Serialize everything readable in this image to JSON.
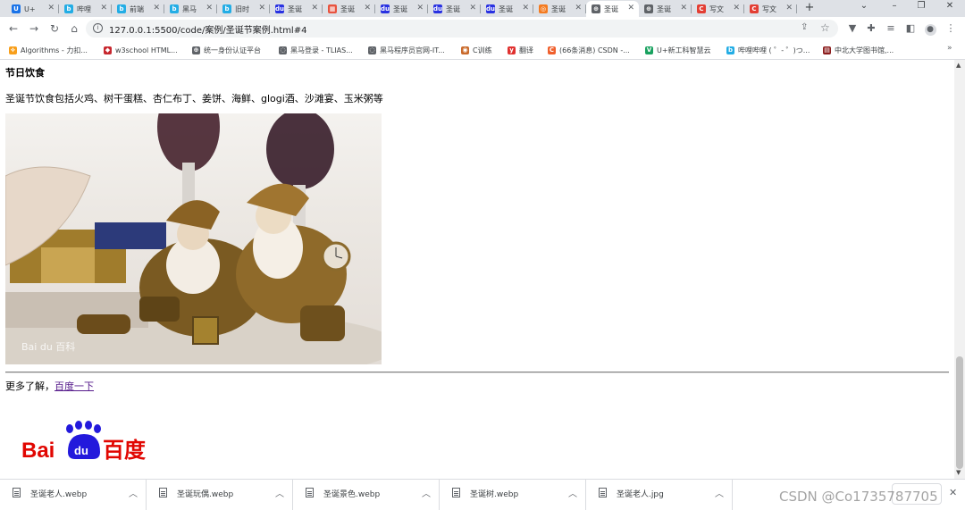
{
  "browser": {
    "tabs": [
      {
        "title": "U+",
        "fav_text": "U",
        "fav_color": "#1a73e8",
        "active": false
      },
      {
        "title": "哔哩",
        "fav_text": "b",
        "fav_color": "#23ade5",
        "active": false
      },
      {
        "title": "前端",
        "fav_text": "b",
        "fav_color": "#23ade5",
        "active": false
      },
      {
        "title": "黑马",
        "fav_text": "b",
        "fav_color": "#23ade5",
        "active": false
      },
      {
        "title": "旧时",
        "fav_text": "b",
        "fav_color": "#23ade5",
        "active": false
      },
      {
        "title": "圣诞",
        "fav_text": "du",
        "fav_color": "#2932e1",
        "active": false
      },
      {
        "title": "圣诞",
        "fav_text": "▦",
        "fav_color": "#e8533f",
        "active": false
      },
      {
        "title": "圣诞",
        "fav_text": "du",
        "fav_color": "#2932e1",
        "active": false
      },
      {
        "title": "圣诞",
        "fav_text": "du",
        "fav_color": "#2932e1",
        "active": false
      },
      {
        "title": "圣诞",
        "fav_text": "du",
        "fav_color": "#2932e1",
        "active": false
      },
      {
        "title": "圣诞",
        "fav_text": "◎",
        "fav_color": "#f47b20",
        "active": false
      },
      {
        "title": "圣诞",
        "fav_text": "⊕",
        "fav_color": "#5f6368",
        "active": true
      },
      {
        "title": "圣诞",
        "fav_text": "⊕",
        "fav_color": "#5f6368",
        "active": false
      },
      {
        "title": "写文",
        "fav_text": "C",
        "fav_color": "#e33e33",
        "active": false
      },
      {
        "title": "写文",
        "fav_text": "C",
        "fav_color": "#e33e33",
        "active": false
      }
    ],
    "address": "127.0.0.1:5500/code/案例/圣诞节案例.html#4",
    "bookmarks": [
      {
        "label": "Algorithms - 力扣...",
        "fav_text": "⟡",
        "fav_color": "#f89f1b"
      },
      {
        "label": "w3school HTML...",
        "fav_text": "◆",
        "fav_color": "#c7272e"
      },
      {
        "label": "统一身份认证平台",
        "fav_text": "⊕",
        "fav_color": "#5f6368"
      },
      {
        "label": "黑马登录 - TLIAS...",
        "fav_text": "◌",
        "fav_color": "#5f6368"
      },
      {
        "label": "黑马程序员官网-IT...",
        "fav_text": "◌",
        "fav_color": "#5f6368"
      },
      {
        "label": "C训练",
        "fav_text": "◉",
        "fav_color": "#c96a2b"
      },
      {
        "label": "翻译",
        "fav_text": "y",
        "fav_color": "#e0312f"
      },
      {
        "label": "(66条消息) CSDN -...",
        "fav_text": "C",
        "fav_color": "#f0602d"
      },
      {
        "label": "U+新工科智慧云",
        "fav_text": "V",
        "fav_color": "#1aa260"
      },
      {
        "label": "哔哩哔哩 ( ゜- ゜)つ...",
        "fav_text": "b",
        "fav_color": "#23ade5"
      },
      {
        "label": "中北大学图书馆,...",
        "fav_text": "▤",
        "fav_color": "#8b1c1c"
      }
    ]
  },
  "page": {
    "heading": "节日饮食",
    "paragraph": "圣诞节饮食包括火鸡、树干蛋糕、杏仁布丁、姜饼、海鲜、glogi酒、沙滩宴、玉米粥等",
    "photo_alt": "Bai du 百科",
    "more_prefix": "更多了解，",
    "more_link": "百度一下",
    "logo_left": "Bai",
    "logo_paw": "du",
    "logo_right": "百度"
  },
  "downloads": {
    "items": [
      {
        "name": "圣诞老人.webp"
      },
      {
        "name": "圣诞玩偶.webp"
      },
      {
        "name": "圣诞景色.webp"
      },
      {
        "name": "圣诞树.webp"
      },
      {
        "name": "圣诞老人.jpg"
      }
    ]
  },
  "watermark": "CSDN @Co1735787705",
  "colors": {
    "baidu_red": "#e10601",
    "baidu_blue": "#2319dc",
    "link_visited": "#551a8b"
  }
}
